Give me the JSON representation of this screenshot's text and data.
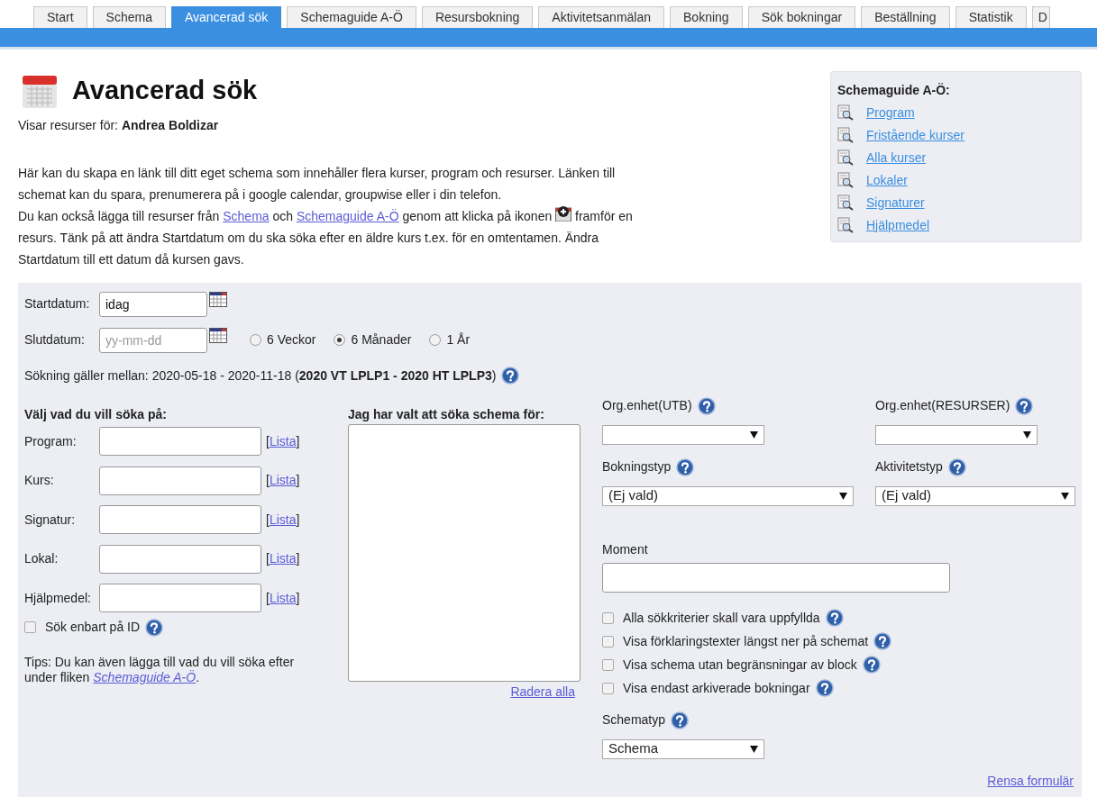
{
  "tabs": [
    {
      "label": "Start",
      "selected": false
    },
    {
      "label": "Schema",
      "selected": false
    },
    {
      "label": "Avancerad sök",
      "selected": true
    },
    {
      "label": "Schemaguide A-Ö",
      "selected": false
    },
    {
      "label": "Resursbokning",
      "selected": false
    },
    {
      "label": "Aktivitetsanmälan",
      "selected": false
    },
    {
      "label": "Bokning",
      "selected": false
    },
    {
      "label": "Sök bokningar",
      "selected": false
    },
    {
      "label": "Beställning",
      "selected": false
    },
    {
      "label": "Statistik",
      "selected": false
    },
    {
      "label": "D",
      "selected": false
    }
  ],
  "header": {
    "title": "Avancerad sök",
    "subtitle": "Visar resurser för: **Andrea Boldizar**"
  },
  "intro": [
    [
      {
        "kind": "text",
        "text": "Här kan du skapa en länk till ditt eget schema som innehåller flera kurser, program och resurser. Länken till schemat kan du spara, prenumerera på i google calendar, groupwise eller i din telefon."
      }
    ],
    [
      {
        "kind": "text",
        "text": "Du kan också lägga till resurser från "
      },
      {
        "kind": "link",
        "text": "Schema"
      },
      {
        "kind": "text",
        "text": " och "
      },
      {
        "kind": "link",
        "text": "Schemaguide A-Ö"
      },
      {
        "kind": "text",
        "text": " genom att klicka på ikonen "
      },
      {
        "kind": "icon"
      },
      {
        "kind": "text",
        "text": " framför en resurs. Tänk på att ändra Startdatum om du ska söka efter en äldre kurs t.ex. för en omtentamen. Ändra Startdatum till ett datum då kursen gavs."
      }
    ]
  ],
  "sidebar": {
    "title": "Schemaguide A-Ö:",
    "links": [
      "Program",
      "Fristående kurser",
      "Alla kurser",
      "Lokaler",
      "Signaturer",
      "Hjälpmedel"
    ]
  },
  "dates": {
    "start": {
      "label": "Startdatum:",
      "value": "idag"
    },
    "end": {
      "label": "Slutdatum:",
      "placeholder": "yy-mm-dd"
    },
    "ranges": [
      {
        "label": "6 Veckor",
        "selected": false
      },
      {
        "label": "6 Månader",
        "selected": true
      },
      {
        "label": "1 År",
        "selected": false
      }
    ],
    "summary": "Sökning gäller mellan: 2020-05-18 - 2020-11-18 (**2020 VT LPLP1 - 2020 HT LPLP3**)"
  },
  "search_on": {
    "title": "Välj vad du vill söka på:",
    "fields": [
      {
        "label": "Program:",
        "link_open": "[",
        "link_text": "Lista",
        "link_close": "]"
      },
      {
        "label": "Kurs:",
        "link_open": "[",
        "link_text": "Lista",
        "link_close": "]"
      },
      {
        "label": "Signatur:",
        "link_open": "[",
        "link_text": "Lista",
        "link_close": "]"
      },
      {
        "label": "Lokal:",
        "link_open": "[",
        "link_text": "Lista",
        "link_close": "]"
      },
      {
        "label": "Hjälpmedel:",
        "link_open": "[",
        "link_text": "Lista",
        "link_close": "]"
      }
    ],
    "id_only": {
      "label": "Sök enbart på ID",
      "checked": false
    },
    "tips": "Tips: Du kan även lägga till vad du vill söka efter under fliken",
    "tips_link": "Schemaguide A-Ö",
    "tips_end": "."
  },
  "chosen": {
    "title": "Jag har valt att söka schema för:",
    "clear_link": "Radera alla"
  },
  "filters": {
    "org_utb": {
      "label": "Org.enhet(UTB)"
    },
    "org_res": {
      "label": "Org.enhet(RESURSER)"
    },
    "bokningstyp": {
      "label": "Bokningstyp",
      "value": "(Ej vald)"
    },
    "aktivitetstyp": {
      "label": "Aktivitetstyp",
      "value": "(Ej vald)"
    },
    "moment": {
      "label": "Moment"
    },
    "options": [
      {
        "label": "Alla sökkriterier skall vara uppfyllda",
        "checked": false
      },
      {
        "label": "Visa förklaringstexter längst ner på schemat",
        "checked": false
      },
      {
        "label": "Visa schema utan begränsningar av block",
        "checked": false
      },
      {
        "label": "Visa endast arkiverade bokningar",
        "checked": false
      }
    ],
    "schematyp": {
      "label": "Schematyp",
      "value": "Schema"
    },
    "reset_link": "Rensa formulär"
  }
}
